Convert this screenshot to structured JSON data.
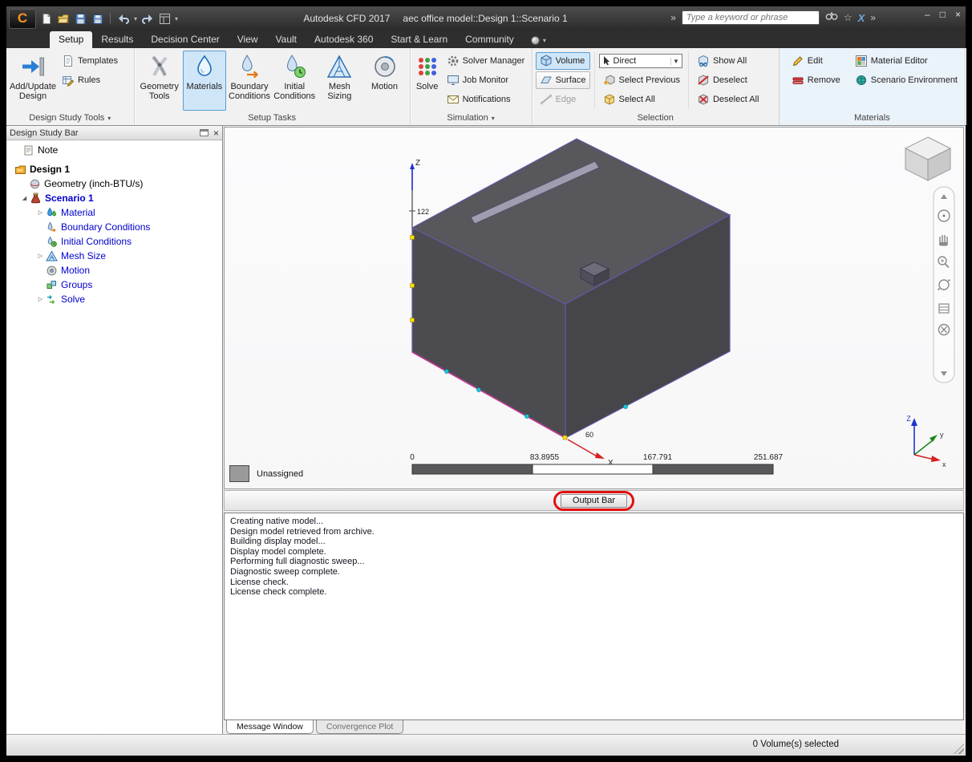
{
  "icons": {
    "app_logo": "C",
    "minimize": "–",
    "maximize": "□",
    "close": "×",
    "dropdown_arrow": "▾",
    "combo_arrow": "▼",
    "chevron_double": "»",
    "star": "☆",
    "expander_collapsed": "▷",
    "expander_expanded": "◢"
  },
  "titlebar": {
    "app_title": "Autodesk CFD 2017",
    "document_title": "aec office model::Design 1::Scenario 1",
    "search_placeholder": "Type a keyword or phrase"
  },
  "menu": {
    "items": [
      "Setup",
      "Results",
      "Decision Center",
      "View",
      "Vault",
      "Autodesk 360",
      "Start & Learn",
      "Community"
    ]
  },
  "ribbon": {
    "design_study_tools": {
      "label": "Design Study Tools",
      "add_update_design": "Add/Update Design",
      "templates": "Templates",
      "rules": "Rules"
    },
    "setup_tasks": {
      "label": "Setup Tasks",
      "geometry_tools": "Geometry Tools",
      "materials": "Materials",
      "boundary_conditions": "Boundary Conditions",
      "initial_conditions": "Initial Conditions",
      "mesh_sizing": "Mesh Sizing",
      "motion": "Motion"
    },
    "simulation": {
      "label": "Simulation",
      "solve": "Solve",
      "solver_manager": "Solver Manager",
      "job_monitor": "Job Monitor",
      "notifications": "Notifications"
    },
    "selection": {
      "label": "Selection",
      "volume": "Volume",
      "surface": "Surface",
      "edge": "Edge",
      "direct": "Direct",
      "select_previous": "Select Previous",
      "select_all": "Select All",
      "show_all": "Show All",
      "deselect": "Deselect",
      "deselect_all": "Deselect All"
    },
    "materials": {
      "label": "Materials",
      "edit": "Edit",
      "remove": "Remove",
      "material_editor": "Material Editor",
      "scenario_environment": "Scenario Environment"
    }
  },
  "design_study_bar": {
    "title": "Design Study Bar",
    "note": "Note",
    "design": "Design 1",
    "geometry": "Geometry (inch-BTU/s)",
    "scenario": "Scenario 1",
    "children": [
      "Material",
      "Boundary Conditions",
      "Initial Conditions",
      "Mesh Size",
      "Motion",
      "Groups",
      "Solve"
    ]
  },
  "viewport": {
    "legend_label": "Unassigned",
    "z_axis_label": "Z",
    "z_tick": "122",
    "x_axis_label": "X",
    "x_tick": "60",
    "ruler_labels": [
      "0",
      "83.8955",
      "167.791",
      "251.687"
    ],
    "triad": {
      "x": "x",
      "y": "y",
      "z": "Z"
    }
  },
  "output_bar": {
    "label": "Output Bar"
  },
  "messages": {
    "lines": [
      "Creating native model...",
      "Design model retrieved from archive.",
      "Building display model...",
      "Display model complete.",
      "Performing full diagnostic sweep...",
      "Diagnostic sweep complete.",
      "License check.",
      "License check complete."
    ]
  },
  "bottom_tabs": {
    "message_window": "Message Window",
    "convergence_plot": "Convergence Plot"
  },
  "status_bar": {
    "selection_status": "0 Volume(s) selected"
  },
  "colors": {
    "selection_highlight": "#cfe5f8",
    "selection_border": "#5a9fd4",
    "annotation_red": "#e01010",
    "model_face": "#4e4e52",
    "model_edge_purple": "#6457a8",
    "model_edge_magenta": "#c23a96",
    "axis_x_red": "#d42020",
    "axis_y_green": "#1a8a1a",
    "axis_z_blue": "#2233cc"
  }
}
